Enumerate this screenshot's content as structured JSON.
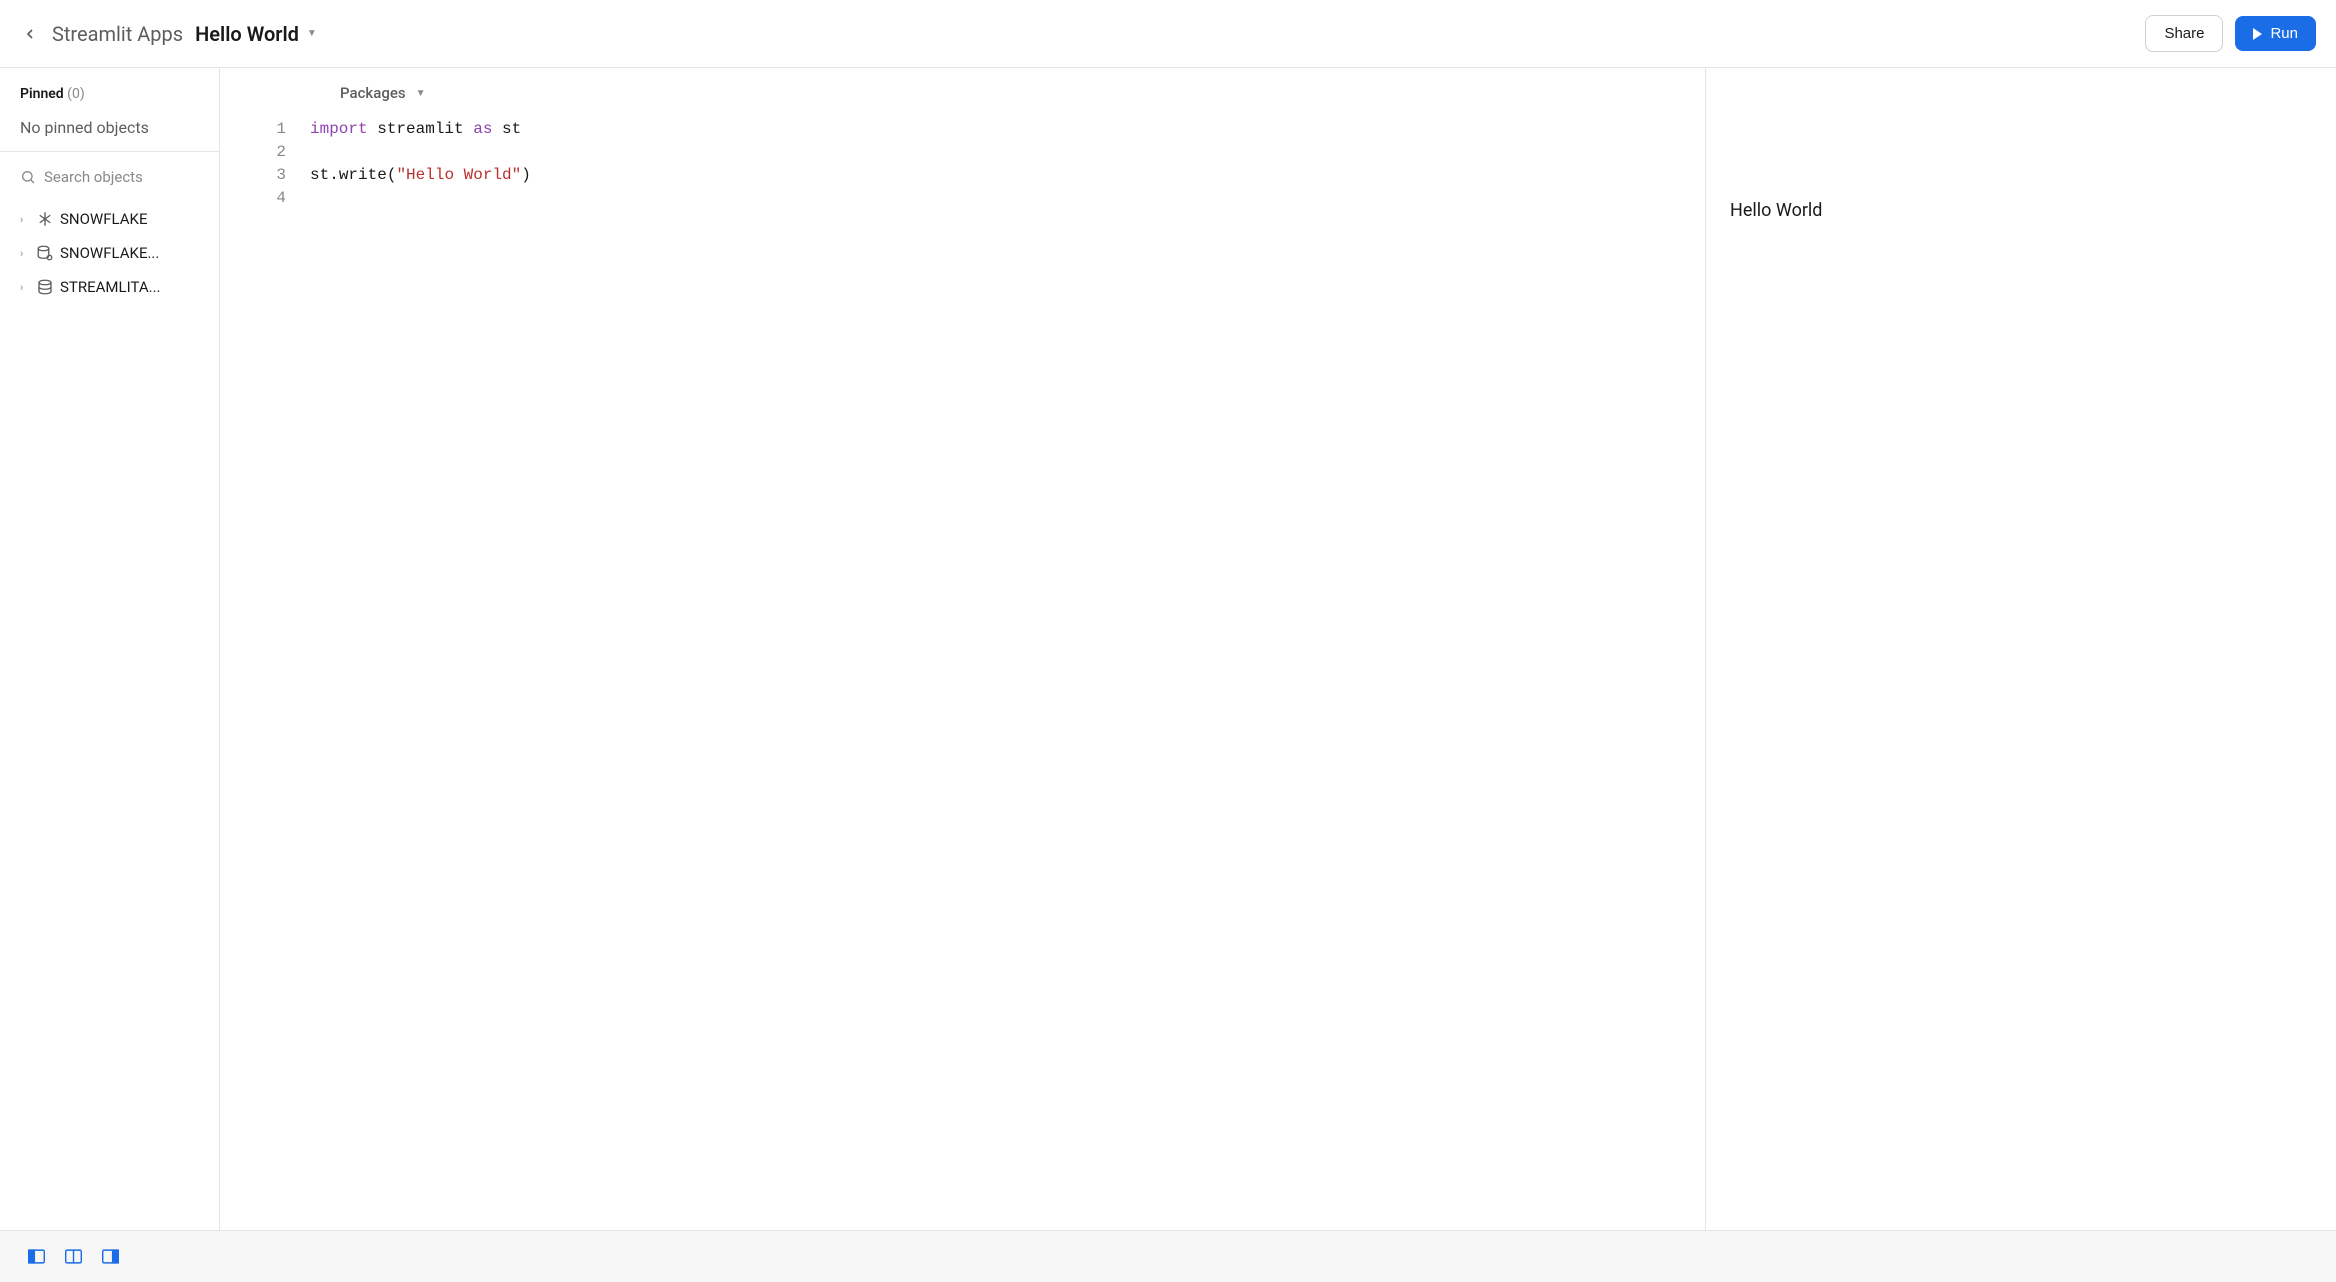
{
  "header": {
    "breadcrumb_parent": "Streamlit Apps",
    "breadcrumb_current": "Hello World",
    "share_label": "Share",
    "run_label": "Run"
  },
  "sidebar": {
    "pinned_label": "Pinned",
    "pinned_count": "(0)",
    "no_pinned_text": "No pinned objects",
    "search_placeholder": "Search objects",
    "tree_items": [
      {
        "label": "SNOWFLAKE",
        "icon": "snowflake"
      },
      {
        "label": "SNOWFLAKE...",
        "icon": "db-special"
      },
      {
        "label": "STREAMLITA...",
        "icon": "database"
      }
    ]
  },
  "editor": {
    "packages_label": "Packages",
    "line_numbers": [
      "1",
      "2",
      "3",
      "4"
    ],
    "code": {
      "line1": {
        "import": "import",
        "module": " streamlit ",
        "as": "as",
        "alias": " st"
      },
      "line3": {
        "obj": "st",
        "dot": ".",
        "method": "write",
        "open": "(",
        "string": "\"Hello World\"",
        "close": ")"
      }
    }
  },
  "preview": {
    "output": "Hello World"
  }
}
